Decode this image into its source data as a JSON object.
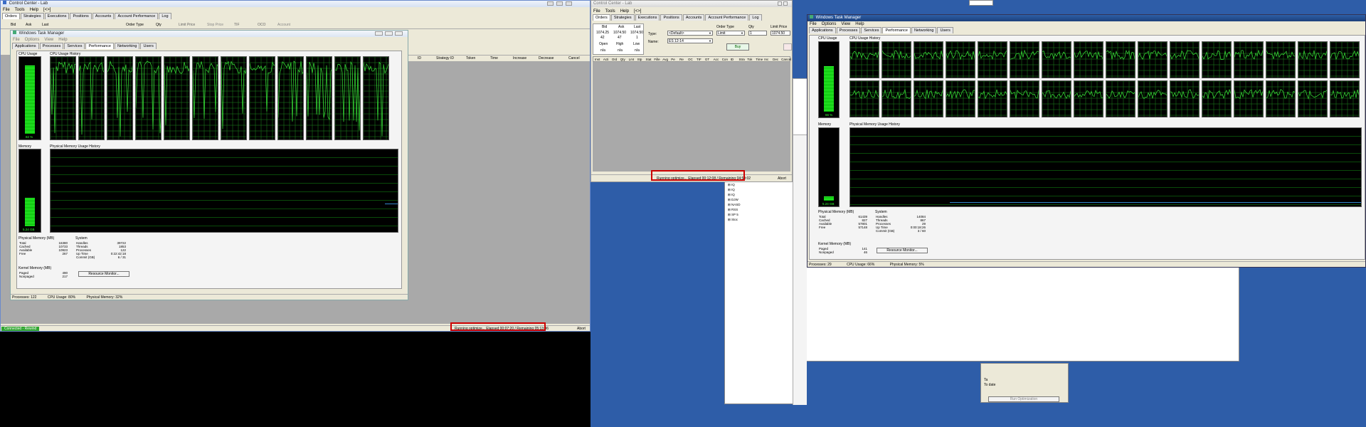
{
  "left_app": {
    "title": "Control Center - Lab",
    "menu": [
      "File",
      "Tools",
      "Help",
      "[<>]"
    ],
    "tabs": [
      "Orders",
      "Strategies",
      "Executions",
      "Positions",
      "Accounts",
      "Account Performance",
      "Log"
    ],
    "order_cols": [
      "Bid",
      "Ask",
      "Last",
      "Order Type",
      "Qty",
      "Limit Price",
      "Stop Price",
      "TIF",
      "OCO",
      "Account"
    ],
    "grid_cols": [
      "ID",
      "Strategy ID",
      "Token",
      "Time",
      "Increase",
      "Decrease",
      "Cancel"
    ],
    "status_connected": "Connected - Rewind",
    "optimize_status": "Running optimize... Elapsed 00:07:20 / Remaining 05:13:36",
    "abort": "Abort"
  },
  "left_tm": {
    "title": "Windows Task Manager",
    "menu": [
      "File",
      "Options",
      "View",
      "Help"
    ],
    "tabs": [
      "Applications",
      "Processes",
      "Services",
      "Performance",
      "Networking",
      "Users"
    ],
    "cpu_usage": "CPU Usage",
    "cpu_history": "CPU Usage History",
    "cpu_pct": "82 %",
    "memory": "Memory",
    "mem_history": "Physical Memory Usage History",
    "mem_value": "5.24 GB",
    "phys_mem_title": "Physical Memory (MB)",
    "phys_mem": [
      [
        "Total",
        "16380"
      ],
      [
        "Cached",
        "10733"
      ],
      [
        "Available",
        "10923"
      ],
      [
        "Free",
        "267"
      ]
    ],
    "system_title": "System",
    "system": [
      [
        "Handles",
        "39722"
      ],
      [
        "Threads",
        "1853"
      ],
      [
        "Processes",
        "122"
      ],
      [
        "Up Time",
        "0:22:42:18"
      ],
      [
        "Commit (GB)",
        "6 / 31"
      ]
    ],
    "kernel_title": "Kernel Memory (MB)",
    "kernel": [
      [
        "Paged",
        "490"
      ],
      [
        "Nonpaged",
        "217"
      ]
    ],
    "resource_btn": "Resource Monitor...",
    "status_processes": "Processes: 122",
    "status_cpu": "CPU Usage: 80%",
    "status_mem": "Physical Memory: 32%"
  },
  "mid_app": {
    "title": "Control Center - Lab",
    "menu": [
      "File",
      "Tools",
      "Help",
      "[<>]"
    ],
    "tabs": [
      "Orders",
      "Strategies",
      "Executions",
      "Positions",
      "Accounts",
      "Account Performance",
      "Log"
    ],
    "bid_label": "Bid",
    "ask_label": "Ask",
    "last_label": "Last",
    "bid": "1074.25",
    "ask": "1074.50",
    "last": "1074.50",
    "bid_size": "42",
    "ask_size": "47",
    "last_size": "1",
    "open_label": "Open",
    "high_label": "High",
    "low_label": "Low",
    "open": "n/a",
    "high": "n/a",
    "low": "n/a",
    "type_label": "Type:",
    "type_value": "<Default>",
    "name_label": "Name:",
    "name_value": "ES 12-14",
    "order_type_label": "Order Type",
    "order_type_value": "Limit",
    "qty_label": "Qty",
    "qty_value": "1",
    "limit_label": "Limit Price",
    "limit_value": "1074.50",
    "buy": "Buy",
    "grid_cols": [
      "Inst",
      "Acti",
      "Ord",
      "Qty",
      "Lmt",
      "Stp",
      "Stat",
      "Fille",
      "Avg",
      "Pe",
      "Re",
      "OC",
      "TIF",
      "GT",
      "Acc",
      "Con",
      "ID",
      "Stra",
      "Tok",
      "Time",
      "Inc",
      "Dec",
      "Cancel"
    ],
    "optimize_status": "Running optimize... Elapsed 00:12:08 / Remaining 04:59:02",
    "abort": "Abort"
  },
  "right_tm": {
    "title": "Windows Task Manager",
    "menu": [
      "File",
      "Options",
      "View",
      "Help"
    ],
    "tabs": [
      "Applications",
      "Processes",
      "Services",
      "Performance",
      "Networking",
      "Users"
    ],
    "cpu_usage": "CPU Usage",
    "cpu_history": "CPU Usage History",
    "cpu_pct": "66 %",
    "memory": "Memory",
    "mem_history": "Physical Memory Usage History",
    "mem_value": "5.24 GB",
    "phys_mem_title": "Physical Memory (MB)",
    "phys_mem": [
      [
        "Total",
        "61439"
      ],
      [
        "Cached",
        "827"
      ],
      [
        "Available",
        "57801"
      ],
      [
        "Free",
        "57148"
      ]
    ],
    "system_title": "System",
    "system": [
      [
        "Handles",
        "14084"
      ],
      [
        "Threads",
        "867"
      ],
      [
        "Processes",
        "29"
      ],
      [
        "Up Time",
        "0:00:18:26"
      ],
      [
        "Commit (GB)",
        "3 / 60"
      ]
    ],
    "kernel_title": "Kernel Memory (MB)",
    "kernel": [
      [
        "Paged",
        "141"
      ],
      [
        "Nonpaged",
        "46"
      ]
    ],
    "resource_btn": "Resource Monitor...",
    "status_processes": "Processes: 29",
    "status_cpu": "CPU Usage: 66%",
    "status_mem": "Physical Memory: 5%"
  },
  "bg_window": {
    "tree_items": [
      "IQ",
      "IQ",
      "IQ",
      "DJW",
      "NASD",
      "RSS",
      "SP 5",
      "Stoc"
    ],
    "panel_title": "Ta",
    "panel_sub": "To date",
    "panel_btn": "Run Optimization"
  },
  "desktop": {
    "bg_color": "#2e5da8"
  }
}
